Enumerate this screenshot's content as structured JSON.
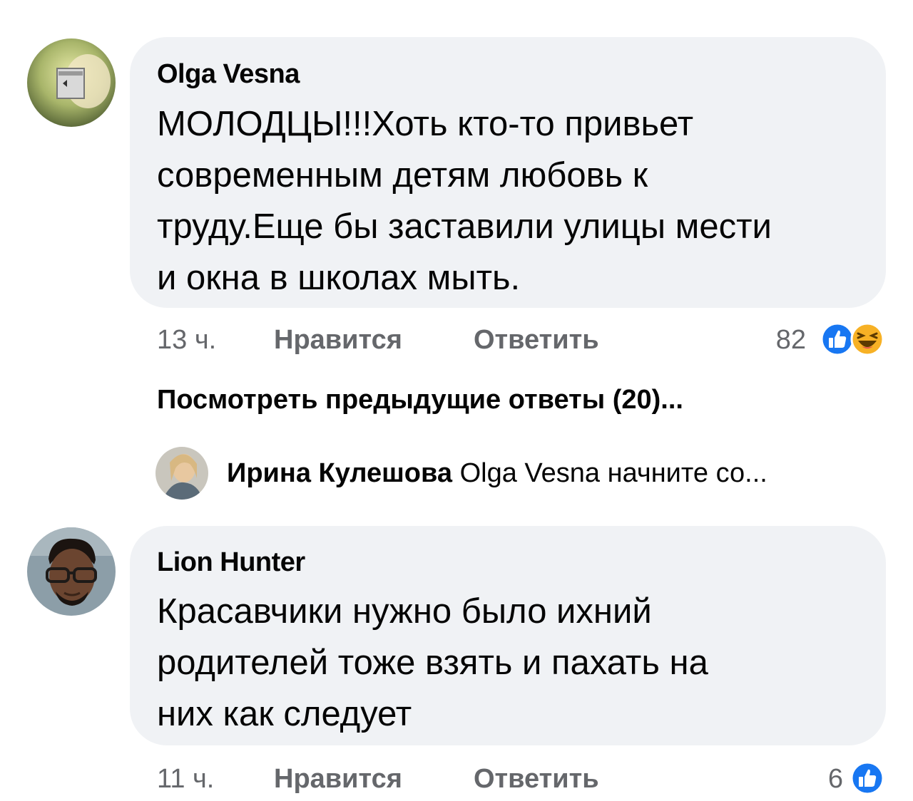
{
  "comments": [
    {
      "author": "Olga Vesna",
      "text": "МОЛОДЦЫ!!!Хоть кто-то привьет современным детям любовь к труду.Еще бы заставили улицы мести и окна в школах мыть.",
      "lines": [
        "МОЛОДЦЫ!!!Хоть кто-то привьет",
        "современным детям любовь к",
        "труду.Еще бы заставили улицы мести",
        "и окна в школах мыть."
      ],
      "time": "13 ч.",
      "like_label": "Нравится",
      "reply_label": "Ответить",
      "reaction_count": "82",
      "reactions": [
        "like-icon",
        "haha-icon"
      ]
    },
    {
      "author": "Lion Hunter",
      "text": "Красавчики нужно было ихний родителей тоже взять и пахать на них как следует",
      "lines": [
        "Красавчики нужно было ихний",
        "родителей тоже взять и пахать на",
        "них как следует"
      ],
      "time": "11 ч.",
      "like_label": "Нравится",
      "reply_label": "Ответить",
      "reaction_count": "6",
      "reactions": [
        "like-icon"
      ]
    }
  ],
  "view_previous": "Посмотреть предыдущие ответы (20)...",
  "reply_preview": {
    "author": "Ирина Кулешова",
    "text": "Olga Vesna начните со..."
  },
  "colors": {
    "bubble": "#f0f2f5",
    "like_blue": "#1877f2",
    "meta_gray": "#65676b",
    "haha_yellow": "#f7b125"
  }
}
